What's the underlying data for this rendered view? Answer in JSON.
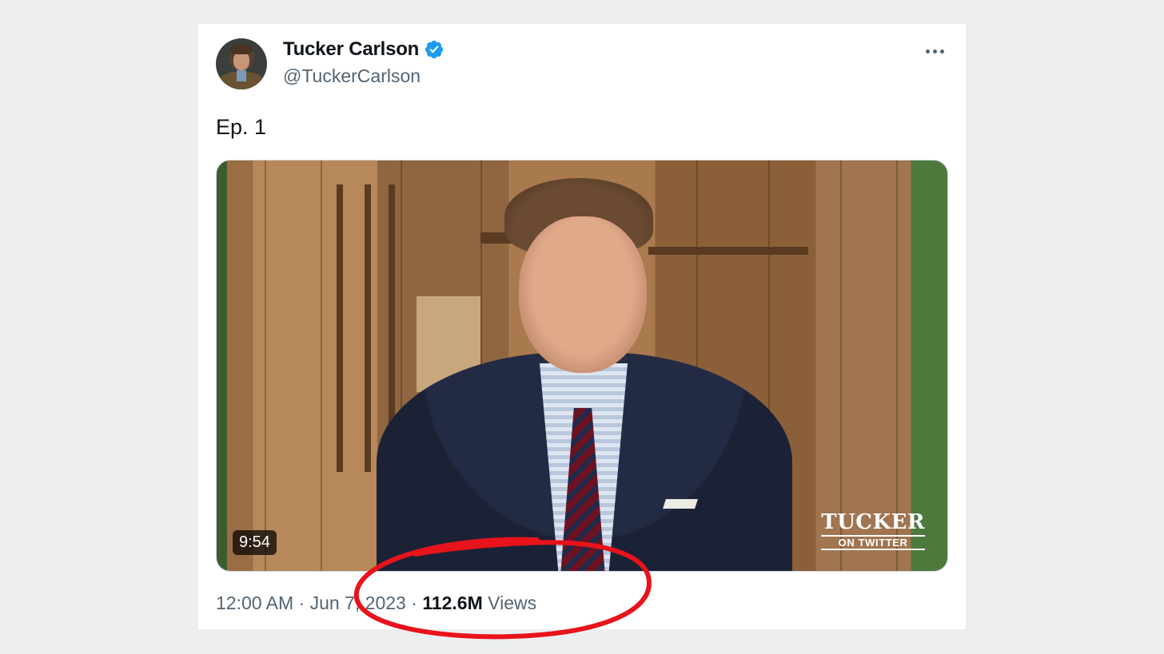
{
  "tweet": {
    "author_name": "Tucker Carlson",
    "handle": "@TuckerCarlson",
    "verified": true,
    "verified_icon": "verified-badge-icon",
    "more_icon": "more-horizontal-icon",
    "text": "Ep. 1",
    "media": {
      "duration": "9:54",
      "brand_line1": "TUCKER",
      "brand_line2": "ON TWITTER"
    },
    "meta": {
      "time": "12:00 AM",
      "separator1": " · ",
      "date": "Jun 7, 2023",
      "separator2": " · ",
      "views_count": "112.6M",
      "views_label": "Views"
    }
  },
  "colors": {
    "background": "#eceef0",
    "card": "#ffffff",
    "verified_blue": "#1d9bf0",
    "secondary_text": "#536471",
    "primary_text": "#0f1419",
    "annotation_red": "#e8131b"
  }
}
